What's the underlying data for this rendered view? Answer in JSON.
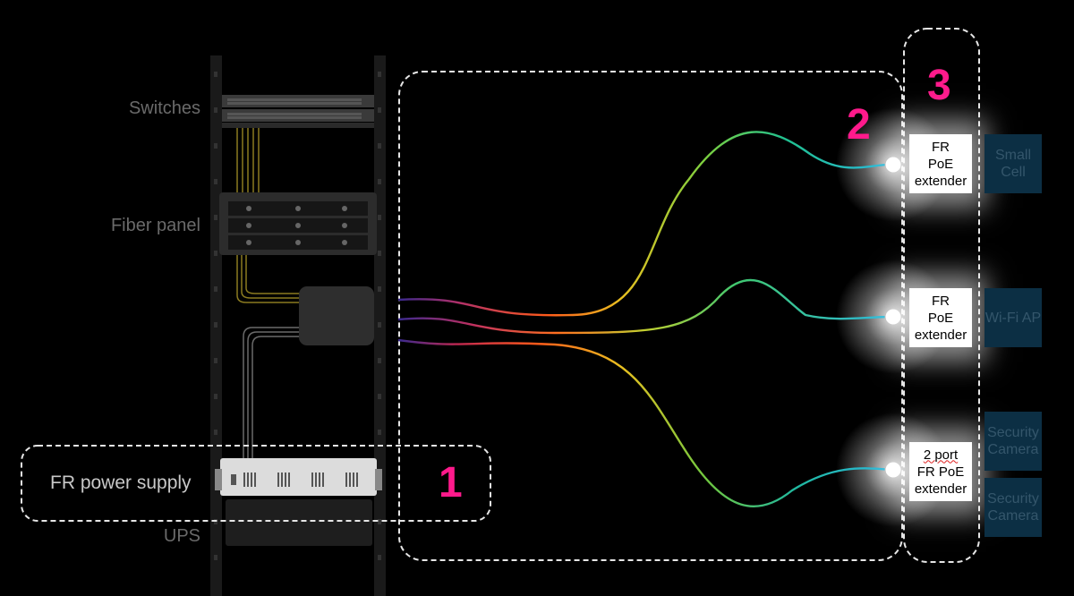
{
  "rack": {
    "switches_label": "Switches",
    "fiber_panel_label": "Fiber panel",
    "power_supply_label": "FR power supply",
    "ups_label": "UPS"
  },
  "zones": {
    "zone1": "1",
    "zone2": "2",
    "zone3": "3"
  },
  "extenders": [
    {
      "line1": "FR",
      "line2": "PoE",
      "line3": "extender"
    },
    {
      "line1": "FR",
      "line2": "PoE",
      "line3": "extender"
    },
    {
      "line1": "2 port",
      "line2": "FR PoE",
      "line3": "extender"
    }
  ],
  "devices": [
    {
      "line1": "Small",
      "line2": "Cell"
    },
    {
      "line1": "Wi-Fi AP",
      "line2": ""
    },
    {
      "line1": "Security",
      "line2": "Camera"
    },
    {
      "line1": "Security",
      "line2": "Camera"
    }
  ],
  "colors": {
    "accent": "#ff1a8c",
    "device_bg": "#0c2f44",
    "cable_start": "#4a2a8a",
    "cable_end": "#2ab8d8"
  }
}
